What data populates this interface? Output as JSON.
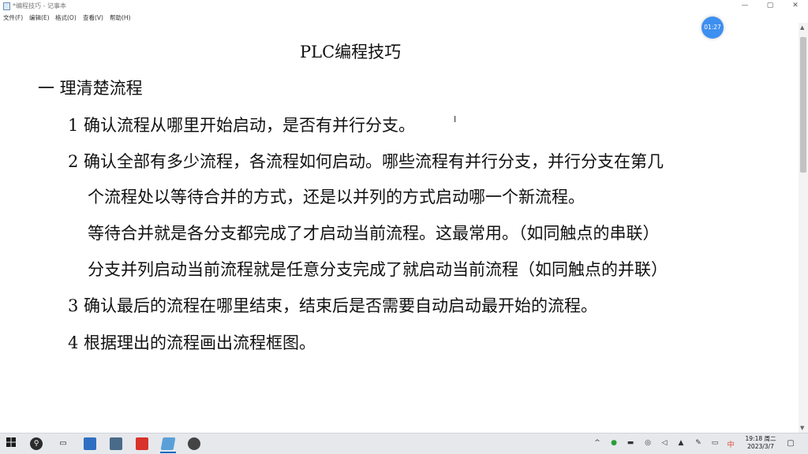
{
  "window": {
    "title": "*编程技巧 - 记事本",
    "controls": {
      "minimize": "—",
      "maximize": "▢",
      "close": "✕"
    }
  },
  "menu": [
    {
      "label": "文件(F)"
    },
    {
      "label": "编辑(E)"
    },
    {
      "label": "格式(O)"
    },
    {
      "label": "查看(V)"
    },
    {
      "label": "帮助(H)"
    }
  ],
  "timer": {
    "text": "01:27"
  },
  "document": {
    "title": "PLC编程技巧",
    "section1": "一  理清楚流程",
    "lines": [
      "1  确认流程从哪里开始启动，是否有并行分支。",
      "2  确认全部有多少流程，各流程如何启动。哪些流程有并行分支，并行分支在第几",
      "个流程处以等待合并的方式，还是以并列的方式启动哪一个新流程。",
      "等待合并就是各分支都完成了才启动当前流程。这最常用。（如同触点的串联）",
      "分支并列启动当前流程就是任意分支完成了就启动当前流程（如同触点的并联）",
      "3  确认最后的流程在哪里结束，结束后是否需要自动启动最开始的流程。",
      "4  根据理出的流程画出流程框图。"
    ],
    "caret": "I"
  },
  "taskbar": {
    "apps": [
      {
        "icon": "windows-start-icon"
      },
      {
        "icon": "search-icon"
      },
      {
        "icon": "task-view-icon"
      },
      {
        "icon": "app-icon",
        "color": "#2f6fc2"
      },
      {
        "icon": "calculator-icon",
        "color": "#4a6a8a"
      },
      {
        "icon": "plc-software-icon",
        "color": "#d8322a"
      },
      {
        "icon": "notepad-icon",
        "color": "#5aa0d8"
      },
      {
        "icon": "recorder-icon",
        "color": "#444444"
      }
    ],
    "tray": {
      "chevron": "^",
      "ime": "中",
      "clock_time": "19:18 周二",
      "clock_date": "2023/3/7"
    }
  }
}
